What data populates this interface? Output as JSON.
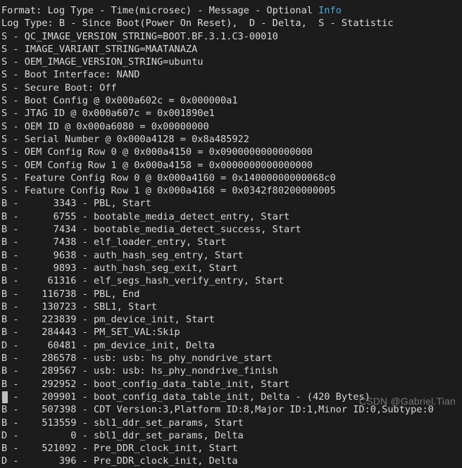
{
  "terminal": {
    "colors": {
      "background": "#1c1c1c",
      "foreground": "#d8d8d8",
      "accent_cyan": "#4fa8e0",
      "cursor": "#bfbfbf",
      "watermark": "#8a8a8a"
    },
    "header": {
      "format_line_prefix": "Format: Log Type - Time(microsec) - Message - Optional ",
      "format_line_accent": "Info",
      "log_type_line": "Log Type: B - Since Boot(Power On Reset),  D - Delta,  S - Statistic"
    },
    "lines": [
      "S - QC_IMAGE_VERSION_STRING=BOOT.BF.3.1.C3-00010",
      "S - IMAGE_VARIANT_STRING=MAATANAZA",
      "S - OEM_IMAGE_VERSION_STRING=ubuntu",
      "S - Boot Interface: NAND",
      "S - Secure Boot: Off",
      "S - Boot Config @ 0x000a602c = 0x000000a1",
      "S - JTAG ID @ 0x000a607c = 0x001890e1",
      "S - OEM ID @ 0x000a6080 = 0x00000000",
      "S - Serial Number @ 0x000a4128 = 0x8a485922",
      "S - OEM Config Row 0 @ 0x000a4150 = 0x0900000000000000",
      "S - OEM Config Row 1 @ 0x000a4158 = 0x0000000000000000",
      "S - Feature Config Row 0 @ 0x000a4160 = 0x14000000000068c0",
      "S - Feature Config Row 1 @ 0x000a4168 = 0x0342f80200000005",
      "B -      3343 - PBL, Start",
      "B -      6755 - bootable_media_detect_entry, Start",
      "B -      7434 - bootable_media_detect_success, Start",
      "B -      7438 - elf_loader_entry, Start",
      "B -      9638 - auth_hash_seg_entry, Start",
      "B -      9893 - auth_hash_seg_exit, Start",
      "B -     61316 - elf_segs_hash_verify_entry, Start",
      "B -    116738 - PBL, End",
      "B -    130723 - SBL1, Start",
      "B -    223839 - pm_device_init, Start",
      "B -    284443 - PM_SET_VAL:Skip",
      "D -     60481 - pm_device_init, Delta",
      "B -    286578 - usb: usb: hs_phy_nondrive_start",
      "B -    289567 - usb: usb: hs_phy_nondrive_finish",
      "B -    292952 - boot_config_data_table_init, Start",
      "D -    209901 - boot_config_data_table_init, Delta - (420 Bytes)",
      "B -    507398 - CDT Version:3,Platform ID:8,Major ID:1,Minor ID:0,Subtype:0",
      "B -    513559 - sbl1_ddr_set_params, Start",
      "D -         0 - sbl1_ddr_set_params, Delta",
      "B -    521092 - Pre_DDR_clock_init, Start",
      "D -       396 - Pre_DDR_clock_init, Delta"
    ],
    "watermark": "CSDN @Gabriel.Tian"
  }
}
